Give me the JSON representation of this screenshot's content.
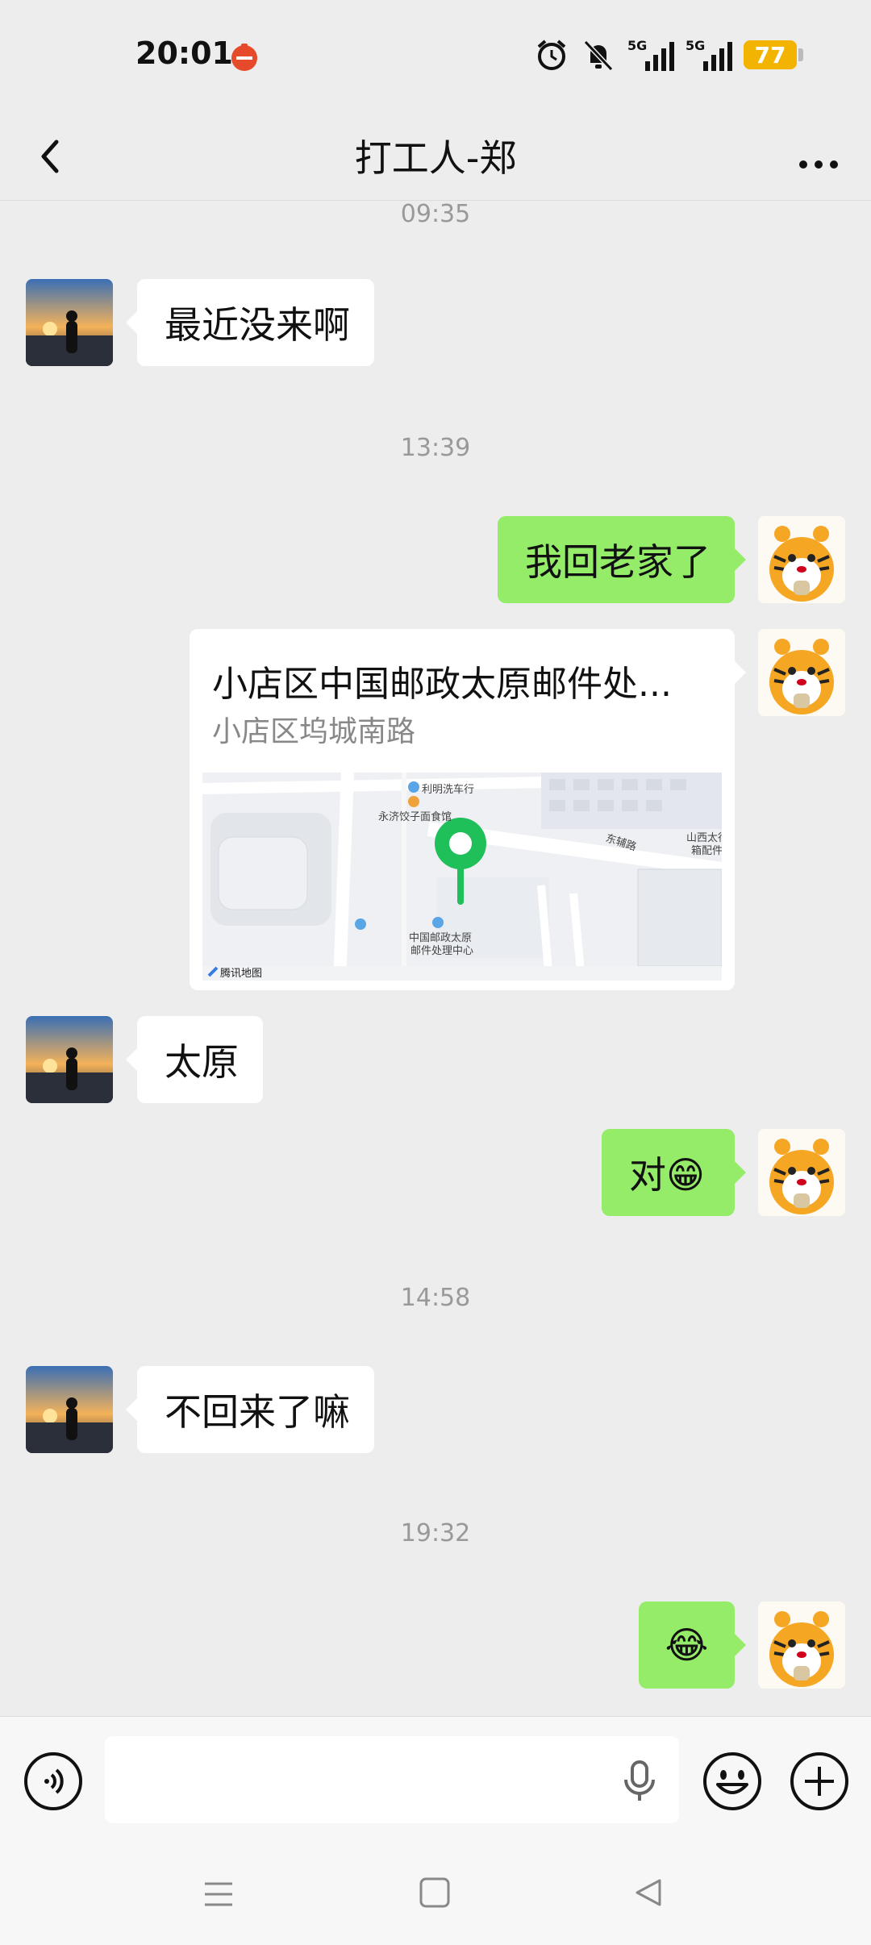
{
  "status_bar": {
    "time": "20:01",
    "network_1": "5G",
    "network_2": "5G",
    "battery_level": "77",
    "icons": [
      "app-notification-icon",
      "alarm-icon",
      "mute-bell-icon",
      "signal-5g-icon",
      "signal-5g-icon",
      "battery-icon"
    ]
  },
  "header": {
    "title": "打工人-郑",
    "back_icon": "chevron-left-icon",
    "more_icon": "more-dots-icon"
  },
  "chat": {
    "timestamps": [
      "09:35",
      "13:39",
      "14:58",
      "19:32"
    ],
    "messages": [
      {
        "side": "in",
        "text": "最近没来啊"
      },
      {
        "side": "out",
        "text": "我回老家了"
      },
      {
        "side": "out",
        "type": "location",
        "title": "小店区中国邮政太原邮件处...",
        "address": "小店区坞城南路"
      },
      {
        "side": "in",
        "text": "太原"
      },
      {
        "side": "out",
        "text": "对😁"
      },
      {
        "side": "in",
        "text": "不回来了嘛"
      },
      {
        "side": "out",
        "text": "😂"
      }
    ],
    "map_labels": {
      "label1": "利明洗车行",
      "label2": "永济饺子面食馆",
      "label3": "东辅路",
      "label4": "山西太行",
      "label5": "箱配件",
      "label6": "中国邮政太原",
      "label7": "邮件处理中心",
      "label8": "腾讯地图"
    }
  },
  "input_bar": {
    "placeholder": "",
    "icons": [
      "voice-icon",
      "microphone-icon",
      "emoji-icon",
      "plus-icon"
    ]
  },
  "nav_bar": {
    "icons": [
      "menu-icon",
      "home-icon",
      "back-triangle-icon"
    ]
  },
  "colors": {
    "background": "#ededed",
    "outgoing_bubble": "#95ec69",
    "incoming_bubble": "#ffffff",
    "map_pin": "#1fbf5a",
    "battery": "#f2b400"
  }
}
